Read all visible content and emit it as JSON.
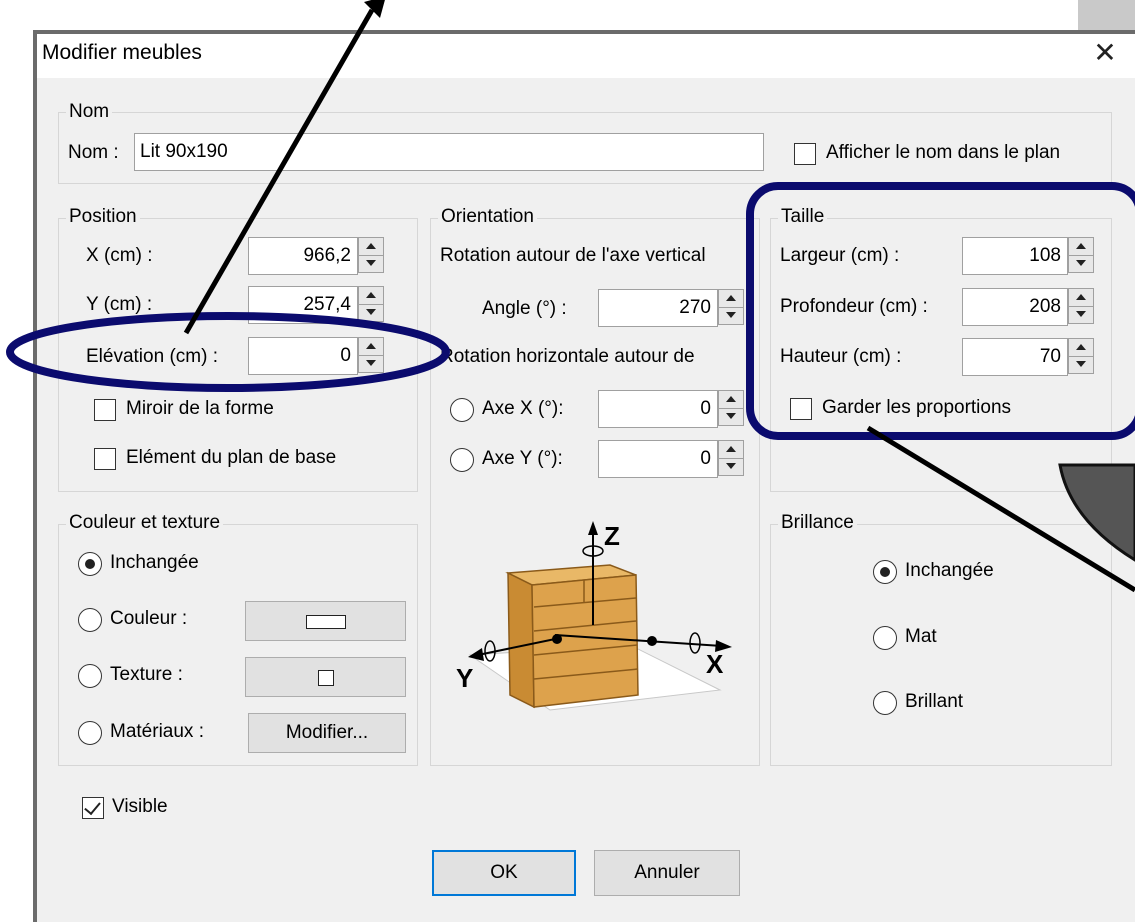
{
  "dialog": {
    "title": "Modifier meubles",
    "close_glyph": "✕"
  },
  "nom_group": {
    "legend": "Nom",
    "label": "Nom :",
    "value": "Lit 90x190",
    "show_name_checkbox": {
      "label": "Afficher le nom dans le plan",
      "checked": false
    }
  },
  "position_group": {
    "legend": "Position",
    "x": {
      "label": "X (cm) :",
      "value": "966,2"
    },
    "y": {
      "label": "Y (cm) :",
      "value": "257,4"
    },
    "elevation": {
      "label": "Elévation (cm) :",
      "value": "0"
    },
    "mirror": {
      "label": "Miroir de la forme",
      "checked": false
    },
    "base_plan": {
      "label": "Elément du plan de base",
      "checked": false
    }
  },
  "orientation_group": {
    "legend": "Orientation",
    "vertical_axis_label": "Rotation autour de l'axe vertical",
    "angle": {
      "label": "Angle (°) :",
      "value": "270"
    },
    "horizontal_label": "Rotation horizontale autour de",
    "axe_x": {
      "label": "Axe X (°):",
      "value": "0",
      "selected": false
    },
    "axe_y": {
      "label": "Axe Y (°):",
      "value": "0",
      "selected": false
    },
    "axis_labels": {
      "z": "Z",
      "x": "X",
      "y": "Y"
    }
  },
  "taille_group": {
    "legend": "Taille",
    "largeur": {
      "label": "Largeur (cm) :",
      "value": "108"
    },
    "profondeur": {
      "label": "Profondeur (cm) :",
      "value": "208"
    },
    "hauteur": {
      "label": "Hauteur (cm) :",
      "value": "70"
    },
    "keep_proportions": {
      "label": "Garder les proportions",
      "checked": false
    }
  },
  "couleur_group": {
    "legend": "Couleur et texture",
    "inchangee": {
      "label": "Inchangée",
      "selected": true
    },
    "couleur": {
      "label": "Couleur :",
      "selected": false
    },
    "texture": {
      "label": "Texture :",
      "selected": false
    },
    "materiaux": {
      "label": "Matériaux :",
      "selected": false,
      "button": "Modifier..."
    }
  },
  "brillance_group": {
    "legend": "Brillance",
    "inchangee": {
      "label": "Inchangée",
      "selected": true
    },
    "mat": {
      "label": "Mat",
      "selected": false
    },
    "brillant": {
      "label": "Brillant",
      "selected": false
    }
  },
  "visible_checkbox": {
    "label": "Visible",
    "checked": true
  },
  "buttons": {
    "ok": "OK",
    "cancel": "Annuler"
  },
  "colors": {
    "annotation": "#0b0b6e",
    "dialog_bg": "#f0f0f0",
    "ok_border": "#0078d7",
    "marker_fill": "#555555"
  }
}
